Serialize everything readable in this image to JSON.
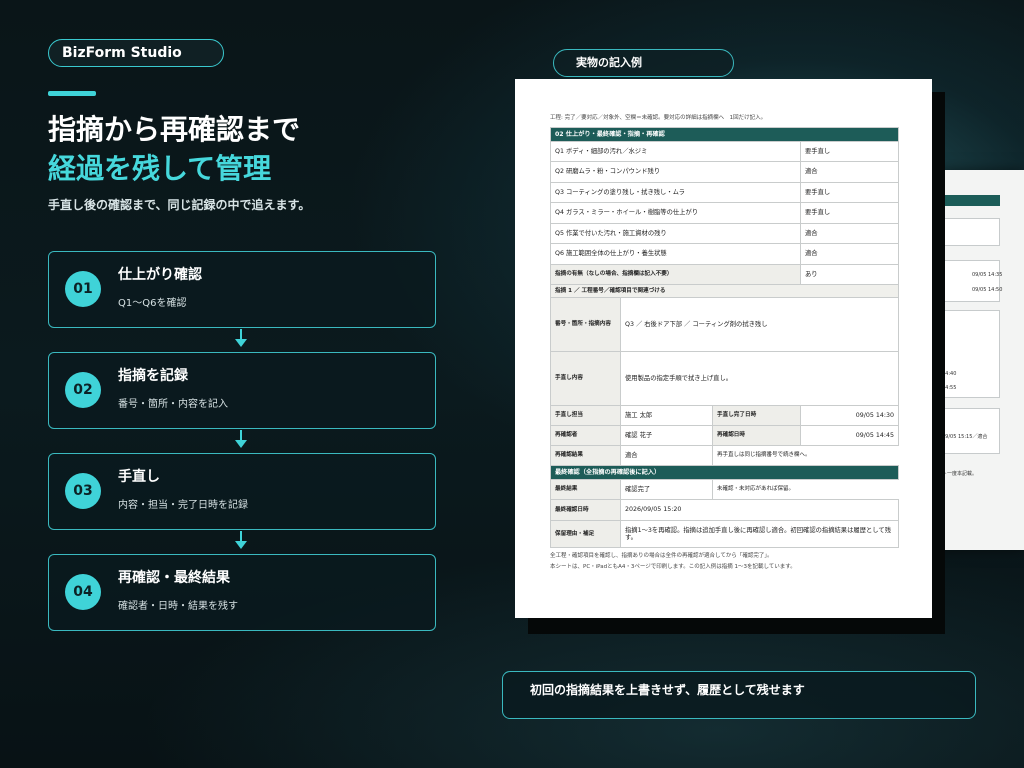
{
  "brand": "BizForm Studio",
  "headline": {
    "line1": "指摘から再確認まで",
    "line2": "経過を残して管理",
    "subtitle": "手直し後の確認まで、同じ記録の中で追えます。"
  },
  "steps": [
    {
      "num": "01",
      "title": "仕上がり確認",
      "desc": "Q1〜Q6を確認"
    },
    {
      "num": "02",
      "title": "指摘を記録",
      "desc": "番号・箇所・内容を記入"
    },
    {
      "num": "03",
      "title": "手直し",
      "desc": "内容・担当・完了日時を記録"
    },
    {
      "num": "04",
      "title": "再確認・最終結果",
      "desc": "確認者・日時・結果を残す"
    }
  ],
  "example_label": "実物の記入例",
  "document": {
    "top_note": "工程: 完了／要対応／対象外、空欄＝未確認。要対応の詳細は指摘欄へ　1回だけ記入。",
    "section1": "02  仕上がり・最終確認・指摘・再確認",
    "questions": [
      {
        "q": "Q1  ボディ・細部の汚れ／水ジミ",
        "a": "要手直し"
      },
      {
        "q": "Q2  研磨ムラ・粉・コンパウンド残り",
        "a": "適合"
      },
      {
        "q": "Q3  コーティングの塗り残し・拭き残し・ムラ",
        "a": "要手直し"
      },
      {
        "q": "Q4  ガラス・ミラー・ホイール・樹脂等の仕上がり",
        "a": "要手直し"
      },
      {
        "q": "Q5  作業で付いた汚れ・施工資材の残り",
        "a": "適合"
      },
      {
        "q": "Q6  施工範囲全体の仕上がり・養生状態",
        "a": "適合"
      }
    ],
    "finding_presence_label": "指摘の有無（なしの場合、指摘欄は記入不要）",
    "finding_presence_value": "あり",
    "finding_header": "指摘 1 ／ 工程番号／確認項目で関連づける",
    "finding_no_label": "番号・箇所・指摘内容",
    "finding_no_value": "Q3 ／ 右後ドア下部 ／ コーティング剤の拭き残し",
    "fix_content_label": "手直し内容",
    "fix_content_value": "使用製品の指定手順で拭き上げ直し。",
    "fix_person_label": "手直し担当",
    "fix_person_value": "施工 太郎",
    "fix_done_label": "手直し完了日時",
    "fix_done_value": "09/05 14:30",
    "recheck_person_label": "再確認者",
    "recheck_person_value": "確認 花子",
    "recheck_date_label": "再確認日時",
    "recheck_date_value": "09/05 14:45",
    "recheck_result_label": "再確認結果",
    "recheck_result_value": "適合",
    "recheck_result_note": "再手直しは同じ指摘番号で続き欄へ。",
    "section2": "最終確認（全指摘の再確認後に記入）",
    "final_result_label": "最終結果",
    "final_result_value": "確認完了",
    "final_result_note": "未確認・未対応があれば保留。",
    "final_date_label": "最終確認日時",
    "final_date_value": "2026/09/05 15:20",
    "reason_label": "保留理由・補足",
    "reason_value": "指摘1〜3を再確認。指摘は追加手直し後に再確認し適合。初回確認の指摘結果は履歴として残す。",
    "foot1": "全工程・確認項目を確認し、指摘ありの場合は全件の再確認が適合してから「確認完了」。",
    "foot2": "本シートは、PC・iPadともA4・3ページで印刷します。この記入例は指摘 1〜3を記載しています。"
  },
  "back_document": {
    "t1": "09/05 14:35",
    "t2": "09/05 14:50",
    "t3": "14:40",
    "t4": "14:55",
    "t5": "09/05 15:15／適合",
    "t6": "ト一度本記載。"
  },
  "bottom_message": "初回の指摘結果を上書きせず、履歴として残せます"
}
